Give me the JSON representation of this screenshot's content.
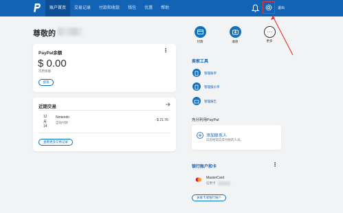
{
  "nav": {
    "items": [
      "账户首页",
      "交易记录",
      "付款和收款",
      "钱包",
      "优惠",
      "帮助"
    ],
    "logout": "退出"
  },
  "greeting": "尊敬的",
  "balance_card": {
    "title": "PayPal余额",
    "kebab": "⋮",
    "amount": "$ 0.00",
    "available": "可用余额",
    "transfer_btn": "提现"
  },
  "recent": {
    "title": "近期交易",
    "date_day": "12",
    "date_month": "月",
    "date_num": "14",
    "merchant": "Nintendo",
    "type": "自动付款",
    "amount": "- $ 21.76",
    "view_more": "查看更多交易记录"
  },
  "quick": {
    "pay": "付款",
    "receive": "收款",
    "more": "更多",
    "more_glyph": "⋯"
  },
  "seller": {
    "title": "卖家工具",
    "items": [
      "管理账单",
      "管理报价单",
      "管理报告"
    ]
  },
  "contacts": {
    "title": "充分利用PayPal",
    "add_title": "添加联系人",
    "add_desc": "向您经常向其付款的人员。"
  },
  "bank": {
    "title": "银行账户和卡",
    "kebab": "⋮",
    "card_name": "MasterCard",
    "card_type": "信用卡",
    "link_btn": "关联卡或银行账户"
  },
  "colors": {
    "nav": "#1263b5",
    "accent": "#0070ba",
    "annotation": "#e53935"
  },
  "icons": [
    "paypal-logo-icon",
    "bell-icon",
    "gear-icon",
    "chevron-right-icon",
    "pay-icon",
    "receive-icon",
    "more-icon",
    "document-icon",
    "plus-icon",
    "mastercard-icon"
  ]
}
